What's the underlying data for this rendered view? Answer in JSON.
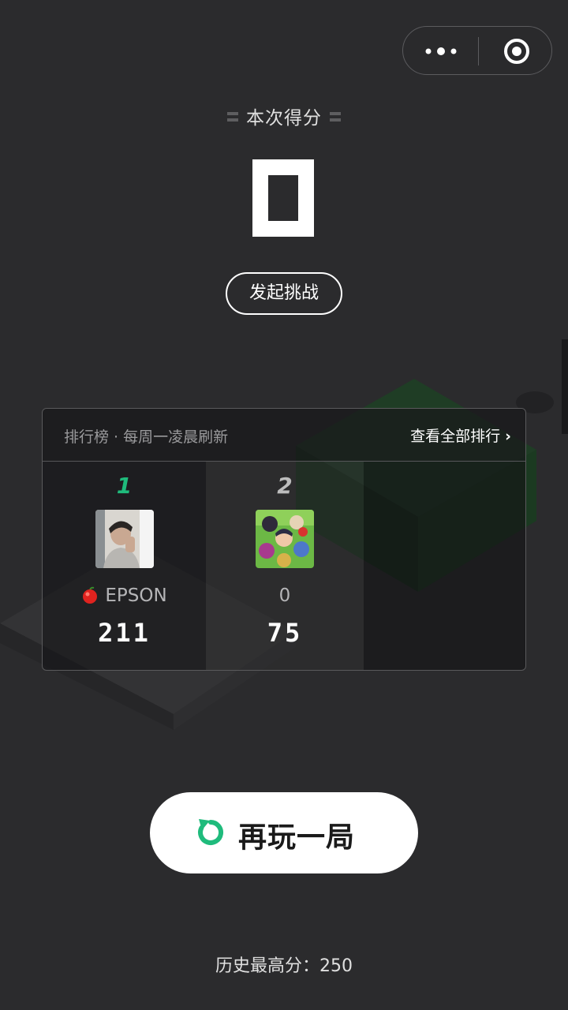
{
  "header": {
    "more_icon": "more-dots-icon",
    "close_icon": "target-circle-icon"
  },
  "score": {
    "title": "本次得分",
    "value": "0"
  },
  "challenge_label": "发起挑战",
  "leaderboard": {
    "title": "排行榜 · 每周一凌晨刷新",
    "view_all": "查看全部排行",
    "entries": [
      {
        "rank": "1",
        "name": "EPSON",
        "score": "211",
        "name_icon": "apple-icon"
      },
      {
        "rank": "2",
        "name": "0",
        "score": "75"
      }
    ]
  },
  "replay_label": "再玩一局",
  "history": "历史最高分：250",
  "colors": {
    "background": "#2b2b2d",
    "accent_green": "#1fbb7c",
    "button_bg": "#ffffff"
  }
}
